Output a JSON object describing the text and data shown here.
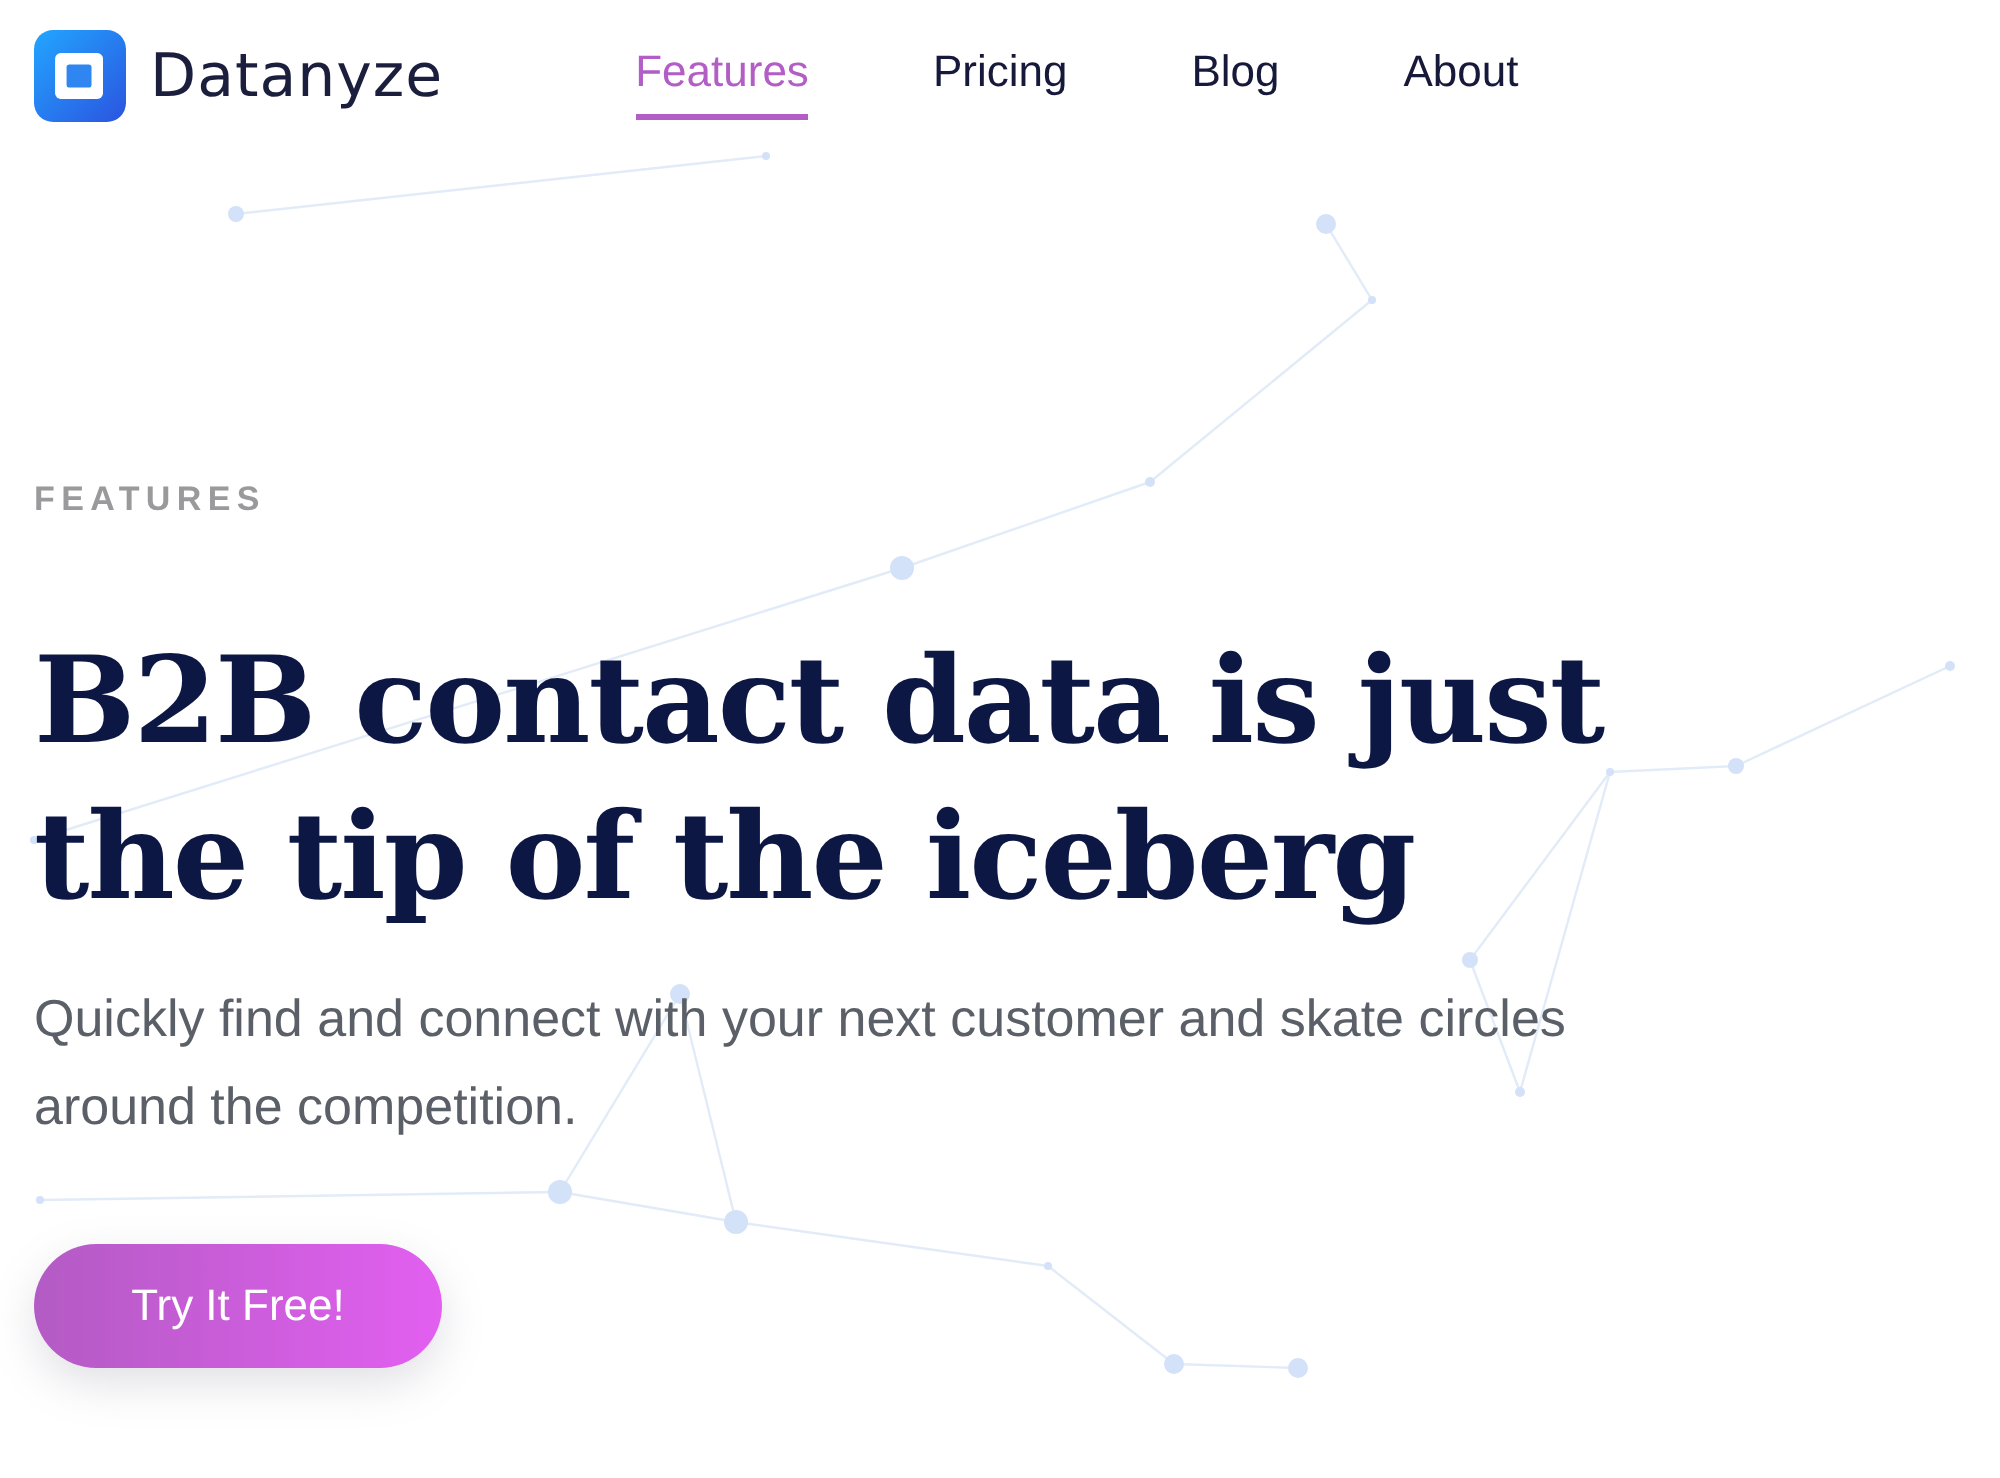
{
  "header": {
    "logo": {
      "text": "Datanyze"
    },
    "nav": [
      {
        "label": "Features",
        "selected": true
      },
      {
        "label": "Pricing",
        "selected": false
      },
      {
        "label": "Blog",
        "selected": false
      },
      {
        "label": "About",
        "selected": false
      }
    ]
  },
  "hero": {
    "eyebrow": "FEATURES",
    "heading": "B2B contact data is just the tip of the iceberg",
    "subtitle": "Quickly find and connect with your next customer and skate circles around the competition.",
    "cta": {
      "label": "Try It Free!"
    }
  }
}
